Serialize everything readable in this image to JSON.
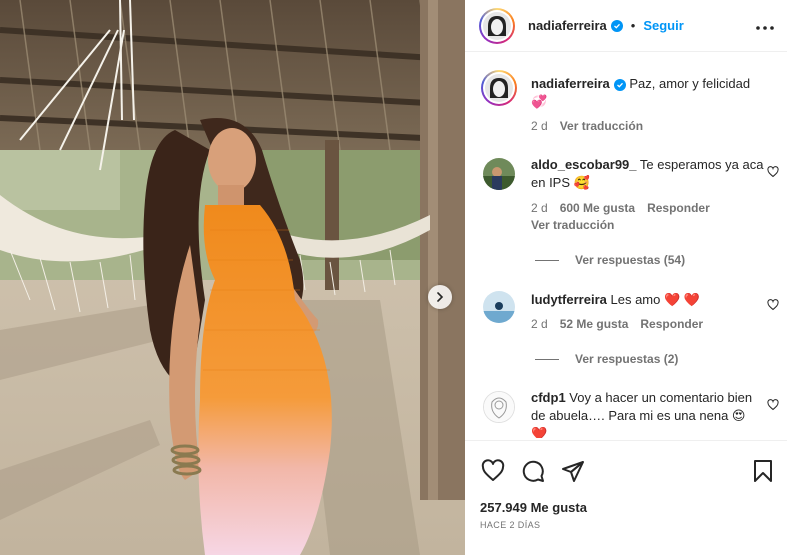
{
  "post": {
    "username": "nadiaferreira",
    "follow_label": "Seguir",
    "more_icon": "more-options-icon",
    "caption_text": "Paz, amor y felicidad",
    "caption_emoji": "💞",
    "caption_time": "2 d",
    "caption_translate": "Ver traducción"
  },
  "comments": [
    {
      "user": "aldo_escobar99_",
      "text": "Te esperamos ya aca en IPS 🥰",
      "time": "2 d",
      "likes": "600 Me gusta",
      "reply": "Responder",
      "translate": "Ver traducción",
      "replies": "Ver respuestas (54)"
    },
    {
      "user": "ludytferreira",
      "text": "Les amo ❤️ ❤️",
      "time": "2 d",
      "likes": "52 Me gusta",
      "reply": "Responder",
      "replies": "Ver respuestas (2)"
    },
    {
      "user": "cfdp1",
      "text": "Voy a hacer un comentario bien de abuela…. Para mi es una nena 😍 ❤️"
    }
  ],
  "footer": {
    "likes": "257.949 Me gusta",
    "time_ago": "HACE 2 DÍAS"
  },
  "colors": {
    "accent": "#0095f6",
    "text": "#262626",
    "muted": "#737373",
    "heart_red": "#ed1c24"
  }
}
